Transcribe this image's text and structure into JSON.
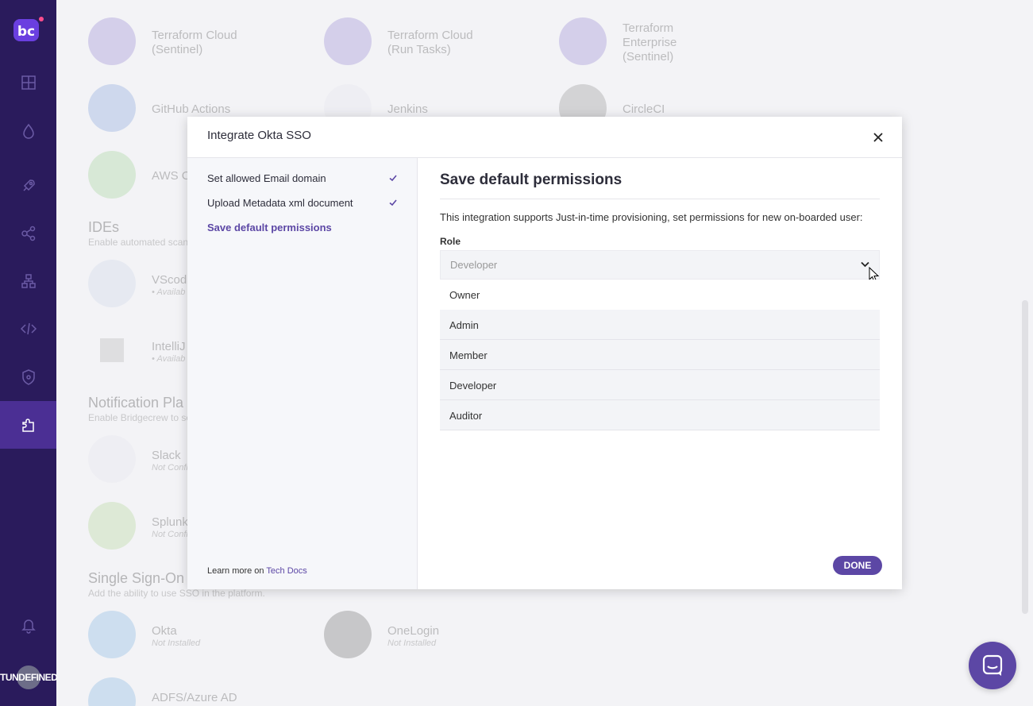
{
  "sidebar": {
    "logo": "bc",
    "items": [
      {
        "name": "dashboard-icon"
      },
      {
        "name": "incidents-icon"
      },
      {
        "name": "deploy-icon"
      },
      {
        "name": "graph-icon"
      },
      {
        "name": "resources-icon"
      },
      {
        "name": "code-icon"
      },
      {
        "name": "security-icon"
      },
      {
        "name": "integrations-icon",
        "active": true
      }
    ],
    "notification_icon": "bell-icon",
    "user_label": "TUNDEFINED"
  },
  "background": {
    "integrations": [
      {
        "name": "Terraform Cloud\n(Sentinel)"
      },
      {
        "name": "Terraform Cloud\n(Run Tasks)"
      },
      {
        "name": "Terraform\nEnterprise\n(Sentinel)"
      },
      {
        "name": "GitHub Actions"
      },
      {
        "name": "Jenkins"
      },
      {
        "name": "CircleCI"
      },
      {
        "name": "AWS C"
      },
      {
        "name": "VScod",
        "status": "• Availab"
      },
      {
        "name": "IntelliJ",
        "status": "• Availab"
      },
      {
        "name": "Slack",
        "status": "Not Confi"
      },
      {
        "name": "Splunk",
        "status": "Not Confi"
      },
      {
        "name": "Okta",
        "status": "Not Installed"
      },
      {
        "name": "OneLogin",
        "status": "Not Installed"
      },
      {
        "name": "ADFS/Azure AD"
      }
    ],
    "sections": {
      "ides_title": "IDEs",
      "ides_desc": "Enable automated scan",
      "notify_title": "Notification Pla",
      "notify_desc": "Enable Bridgecrew to se",
      "sso_title": "Single Sign-On",
      "sso_desc": "Add the ability to use SSO in the platform."
    }
  },
  "modal": {
    "title": "Integrate Okta SSO",
    "steps": [
      {
        "label": "Set allowed Email domain",
        "done": true
      },
      {
        "label": "Upload Metadata xml document",
        "done": true
      },
      {
        "label": "Save default permissions",
        "active": true
      }
    ],
    "learn_prefix": "Learn more on ",
    "learn_link": "Tech Docs",
    "content_title": "Save default permissions",
    "content_desc": "This integration supports Just-in-time provisioning, set permissions for new on-boarded user:",
    "role_label": "Role",
    "role_value": "Developer",
    "role_options": [
      "Owner",
      "Admin",
      "Member",
      "Developer",
      "Auditor"
    ],
    "done_label": "DONE"
  },
  "colors": {
    "sidebar_bg": "#2a1b5c",
    "accent": "#5c47a5"
  }
}
